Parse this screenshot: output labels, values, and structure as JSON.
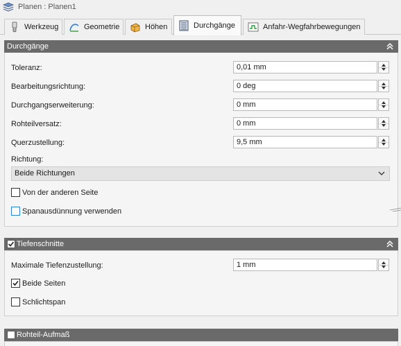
{
  "window": {
    "title": "Planen : Planen1",
    "title_icon": "layers-icon"
  },
  "tabs": [
    {
      "label": "Werkzeug",
      "icon": "tool-icon"
    },
    {
      "label": "Geometrie",
      "icon": "geometry-icon"
    },
    {
      "label": "Höhen",
      "icon": "heights-icon"
    },
    {
      "label": "Durchgänge",
      "icon": "passes-icon"
    },
    {
      "label": "Anfahr-Wegfahrbewegungen",
      "icon": "linking-icon"
    }
  ],
  "active_tab": "Durchgänge",
  "section_passes": {
    "title": "Durchgänge",
    "fields": [
      {
        "label": "Toleranz:",
        "value": "0,01 mm"
      },
      {
        "label": "Bearbeitungsrichtung:",
        "value": "0 deg"
      },
      {
        "label": "Durchgangserweiterung:",
        "value": "0 mm"
      },
      {
        "label": "Rohteilversatz:",
        "value": "0 mm"
      },
      {
        "label": "Querzustellung:",
        "value": "9,5 mm"
      }
    ],
    "direction_label": "Richtung:",
    "direction_value": "Beide Richtungen",
    "other_side_label": "Von der anderen Seite",
    "other_side_checked": false,
    "chip_thinning_label": "Spanausdünnung verwenden",
    "chip_thinning_checked": false
  },
  "section_depth": {
    "title": "Tiefenschnitte",
    "enabled": true,
    "max_stepdown_label": "Maximale Tiefenzustellung:",
    "max_stepdown_value": "1 mm",
    "both_sides_label": "Beide Seiten",
    "both_sides_checked": true,
    "finishing_label": "Schlichtspan",
    "finishing_checked": false
  },
  "section_stock": {
    "title": "Rohteil-Aufmaß",
    "enabled": false
  },
  "colors": {
    "header_bg": "#6a6a6a",
    "focus_blue": "#2f7fd1"
  }
}
